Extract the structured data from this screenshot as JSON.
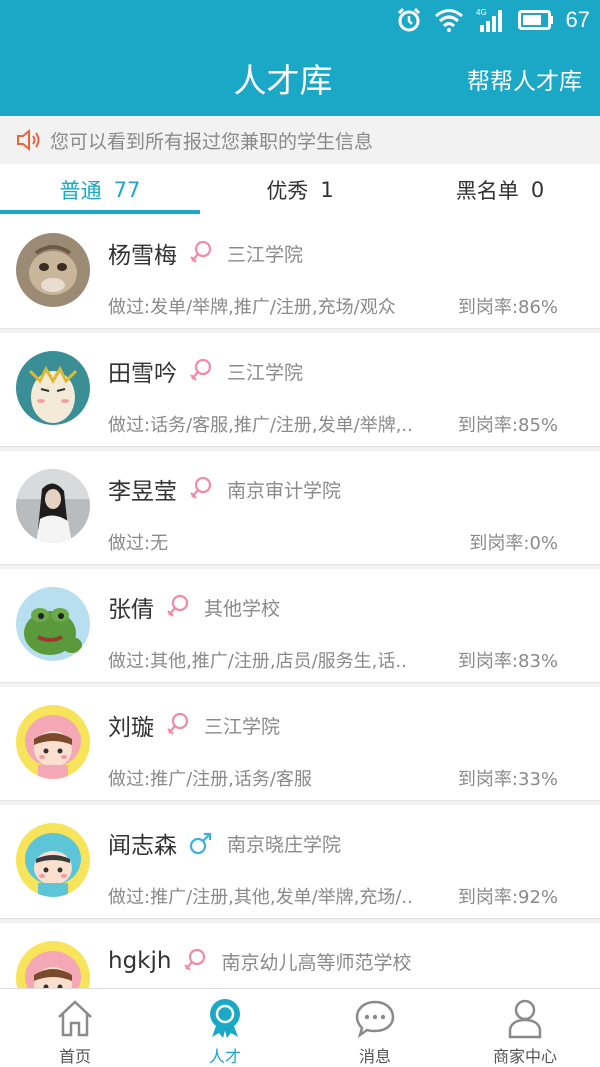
{
  "status_bar": {
    "battery": "67"
  },
  "header": {
    "title": "人才库",
    "right_link": "帮帮人才库"
  },
  "notice": {
    "icon": "speaker-icon",
    "text": "您可以看到所有报过您兼职的学生信息"
  },
  "tabs": [
    {
      "label": "普通",
      "count": "77",
      "active": true
    },
    {
      "label": "优秀",
      "count": "1",
      "active": false
    },
    {
      "label": "黑名单",
      "count": "0",
      "active": false
    }
  ],
  "students": [
    {
      "name": "杨雪梅",
      "gender": "female",
      "school": "三江学院",
      "did": "做过:发单/举牌,推广/注册,充场/观众",
      "rate": "到岗率:86%",
      "avatar": "monkey-photo"
    },
    {
      "name": "田雪吟",
      "gender": "female",
      "school": "三江学院",
      "did": "做过:话务/客服,推广/注册,发单/举牌,..",
      "rate": "到岗率:85%",
      "avatar": "cartoon-face"
    },
    {
      "name": "李昱莹",
      "gender": "female",
      "school": "南京审计学院",
      "did": "做过:无",
      "rate": "到岗率:0%",
      "avatar": "girl-photo"
    },
    {
      "name": "张倩",
      "gender": "female",
      "school": "其他学校",
      "did": "做过:其他,推广/注册,店员/服务生,话..",
      "rate": "到岗率:83%",
      "avatar": "pepe-frog"
    },
    {
      "name": "刘璇",
      "gender": "female",
      "school": "三江学院",
      "did": "做过:推广/注册,话务/客服",
      "rate": "到岗率:33%",
      "avatar": "pink-hood-girl"
    },
    {
      "name": "闻志森",
      "gender": "male",
      "school": "南京晓庄学院",
      "did": "做过:推广/注册,其他,发单/举牌,充场/..",
      "rate": "到岗率:92%",
      "avatar": "blue-hood-boy"
    },
    {
      "name": "hgkjh",
      "gender": "female",
      "school": "南京幼儿高等师范学校",
      "did": "",
      "rate": "",
      "avatar": "pink-hood-girl"
    }
  ],
  "bottom_nav": [
    {
      "label": "首页",
      "icon": "home-icon",
      "active": false
    },
    {
      "label": "人才",
      "icon": "award-icon",
      "active": true
    },
    {
      "label": "消息",
      "icon": "chat-bubble-icon",
      "active": false
    },
    {
      "label": "商家中心",
      "icon": "person-icon",
      "active": false
    }
  ],
  "colors": {
    "primary": "#1ba8c7",
    "female": "#f08aa6",
    "male": "#3fb0d8"
  }
}
